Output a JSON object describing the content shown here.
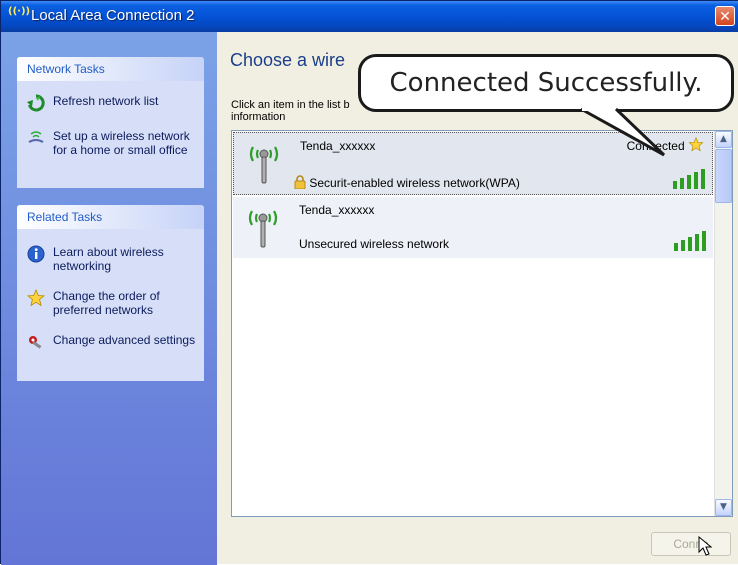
{
  "window": {
    "title": "Local Area Connection 2",
    "close_label": "✕"
  },
  "sidebar": {
    "network_tasks": {
      "header": "Network Tasks",
      "items": [
        {
          "label": "Refresh network list",
          "icon": "refresh-icon"
        },
        {
          "label": "Set up a wireless network for a home or small office",
          "icon": "wireless-setup-icon"
        }
      ]
    },
    "related_tasks": {
      "header": "Related Tasks",
      "items": [
        {
          "label": "Learn about wireless networking",
          "icon": "info-icon"
        },
        {
          "label": "Change the order of preferred networks",
          "icon": "star-icon"
        },
        {
          "label": "Change advanced settings",
          "icon": "settings-icon"
        }
      ]
    }
  },
  "main": {
    "heading": "Choose a wire",
    "description": "Click an item in the list b information"
  },
  "networks": [
    {
      "name": "Tenda_xxxxxx",
      "status": "Connected",
      "security": "Securit-enabled wireless network(WPA)",
      "signal_bars": 5,
      "secured": true
    },
    {
      "name": "Tenda_xxxxxx",
      "status": "",
      "security": "Unsecured wireless network",
      "signal_bars": 5,
      "secured": false
    }
  ],
  "buttons": {
    "connect": "Conne"
  },
  "callout": "Connected Successfully.",
  "colors": {
    "titlebar": "#0553d6",
    "sidebar": "#6375d6",
    "signal": "#2e9e22",
    "heading": "#1b3f8b"
  }
}
